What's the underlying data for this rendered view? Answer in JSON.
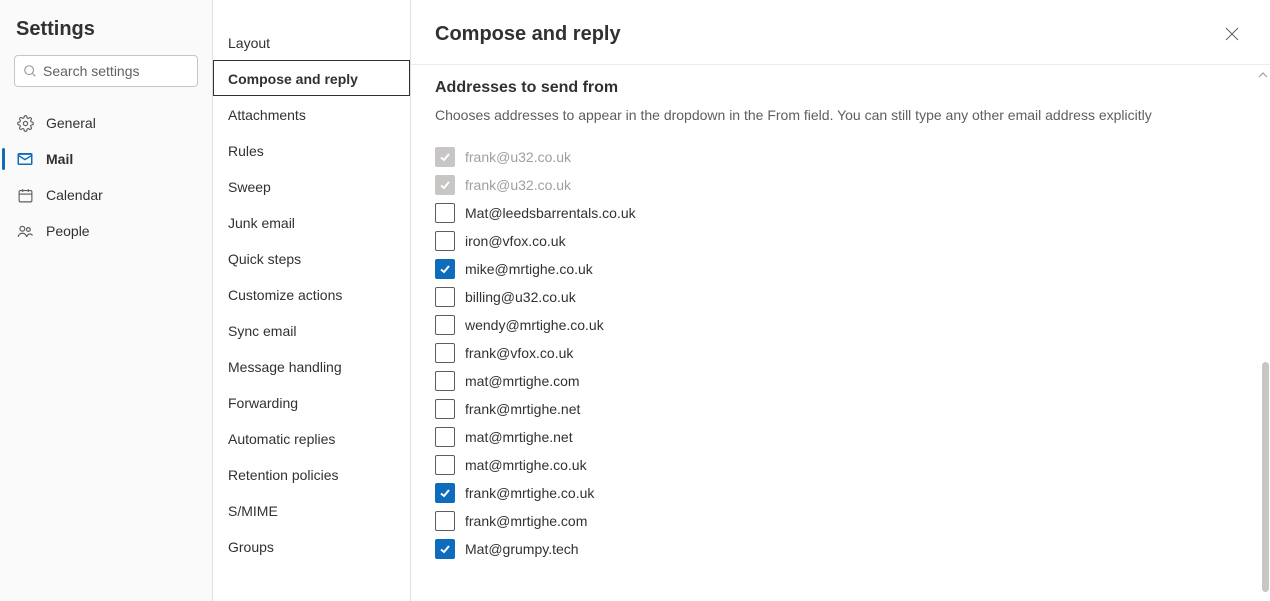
{
  "title": "Settings",
  "search": {
    "placeholder": "Search settings"
  },
  "categories": [
    {
      "icon": "gear",
      "label": "General",
      "active": false
    },
    {
      "icon": "mail",
      "label": "Mail",
      "active": true
    },
    {
      "icon": "calendar",
      "label": "Calendar",
      "active": false
    },
    {
      "icon": "people",
      "label": "People",
      "active": false
    }
  ],
  "submenu": [
    {
      "label": "Layout",
      "selected": false
    },
    {
      "label": "Compose and reply",
      "selected": true
    },
    {
      "label": "Attachments",
      "selected": false
    },
    {
      "label": "Rules",
      "selected": false
    },
    {
      "label": "Sweep",
      "selected": false
    },
    {
      "label": "Junk email",
      "selected": false
    },
    {
      "label": "Quick steps",
      "selected": false
    },
    {
      "label": "Customize actions",
      "selected": false
    },
    {
      "label": "Sync email",
      "selected": false
    },
    {
      "label": "Message handling",
      "selected": false
    },
    {
      "label": "Forwarding",
      "selected": false
    },
    {
      "label": "Automatic replies",
      "selected": false
    },
    {
      "label": "Retention policies",
      "selected": false
    },
    {
      "label": "S/MIME",
      "selected": false
    },
    {
      "label": "Groups",
      "selected": false
    }
  ],
  "main": {
    "heading": "Compose and reply",
    "section_title": "Addresses to send from",
    "section_desc": "Chooses addresses to appear in the dropdown in the From field. You can still type any other email address explicitly",
    "addresses": [
      {
        "email": "frank@u32.co.uk",
        "checked": true,
        "disabled": true
      },
      {
        "email": "frank@u32.co.uk",
        "checked": true,
        "disabled": true
      },
      {
        "email": "Mat@leedsbarrentals.co.uk",
        "checked": false,
        "disabled": false
      },
      {
        "email": "iron@vfox.co.uk",
        "checked": false,
        "disabled": false
      },
      {
        "email": "mike@mrtighe.co.uk",
        "checked": true,
        "disabled": false
      },
      {
        "email": "billing@u32.co.uk",
        "checked": false,
        "disabled": false
      },
      {
        "email": "wendy@mrtighe.co.uk",
        "checked": false,
        "disabled": false
      },
      {
        "email": "frank@vfox.co.uk",
        "checked": false,
        "disabled": false
      },
      {
        "email": "mat@mrtighe.com",
        "checked": false,
        "disabled": false
      },
      {
        "email": "frank@mrtighe.net",
        "checked": false,
        "disabled": false
      },
      {
        "email": "mat@mrtighe.net",
        "checked": false,
        "disabled": false
      },
      {
        "email": "mat@mrtighe.co.uk",
        "checked": false,
        "disabled": false
      },
      {
        "email": "frank@mrtighe.co.uk",
        "checked": true,
        "disabled": false
      },
      {
        "email": "frank@mrtighe.com",
        "checked": false,
        "disabled": false
      },
      {
        "email": "Mat@grumpy.tech",
        "checked": true,
        "disabled": false
      }
    ]
  }
}
